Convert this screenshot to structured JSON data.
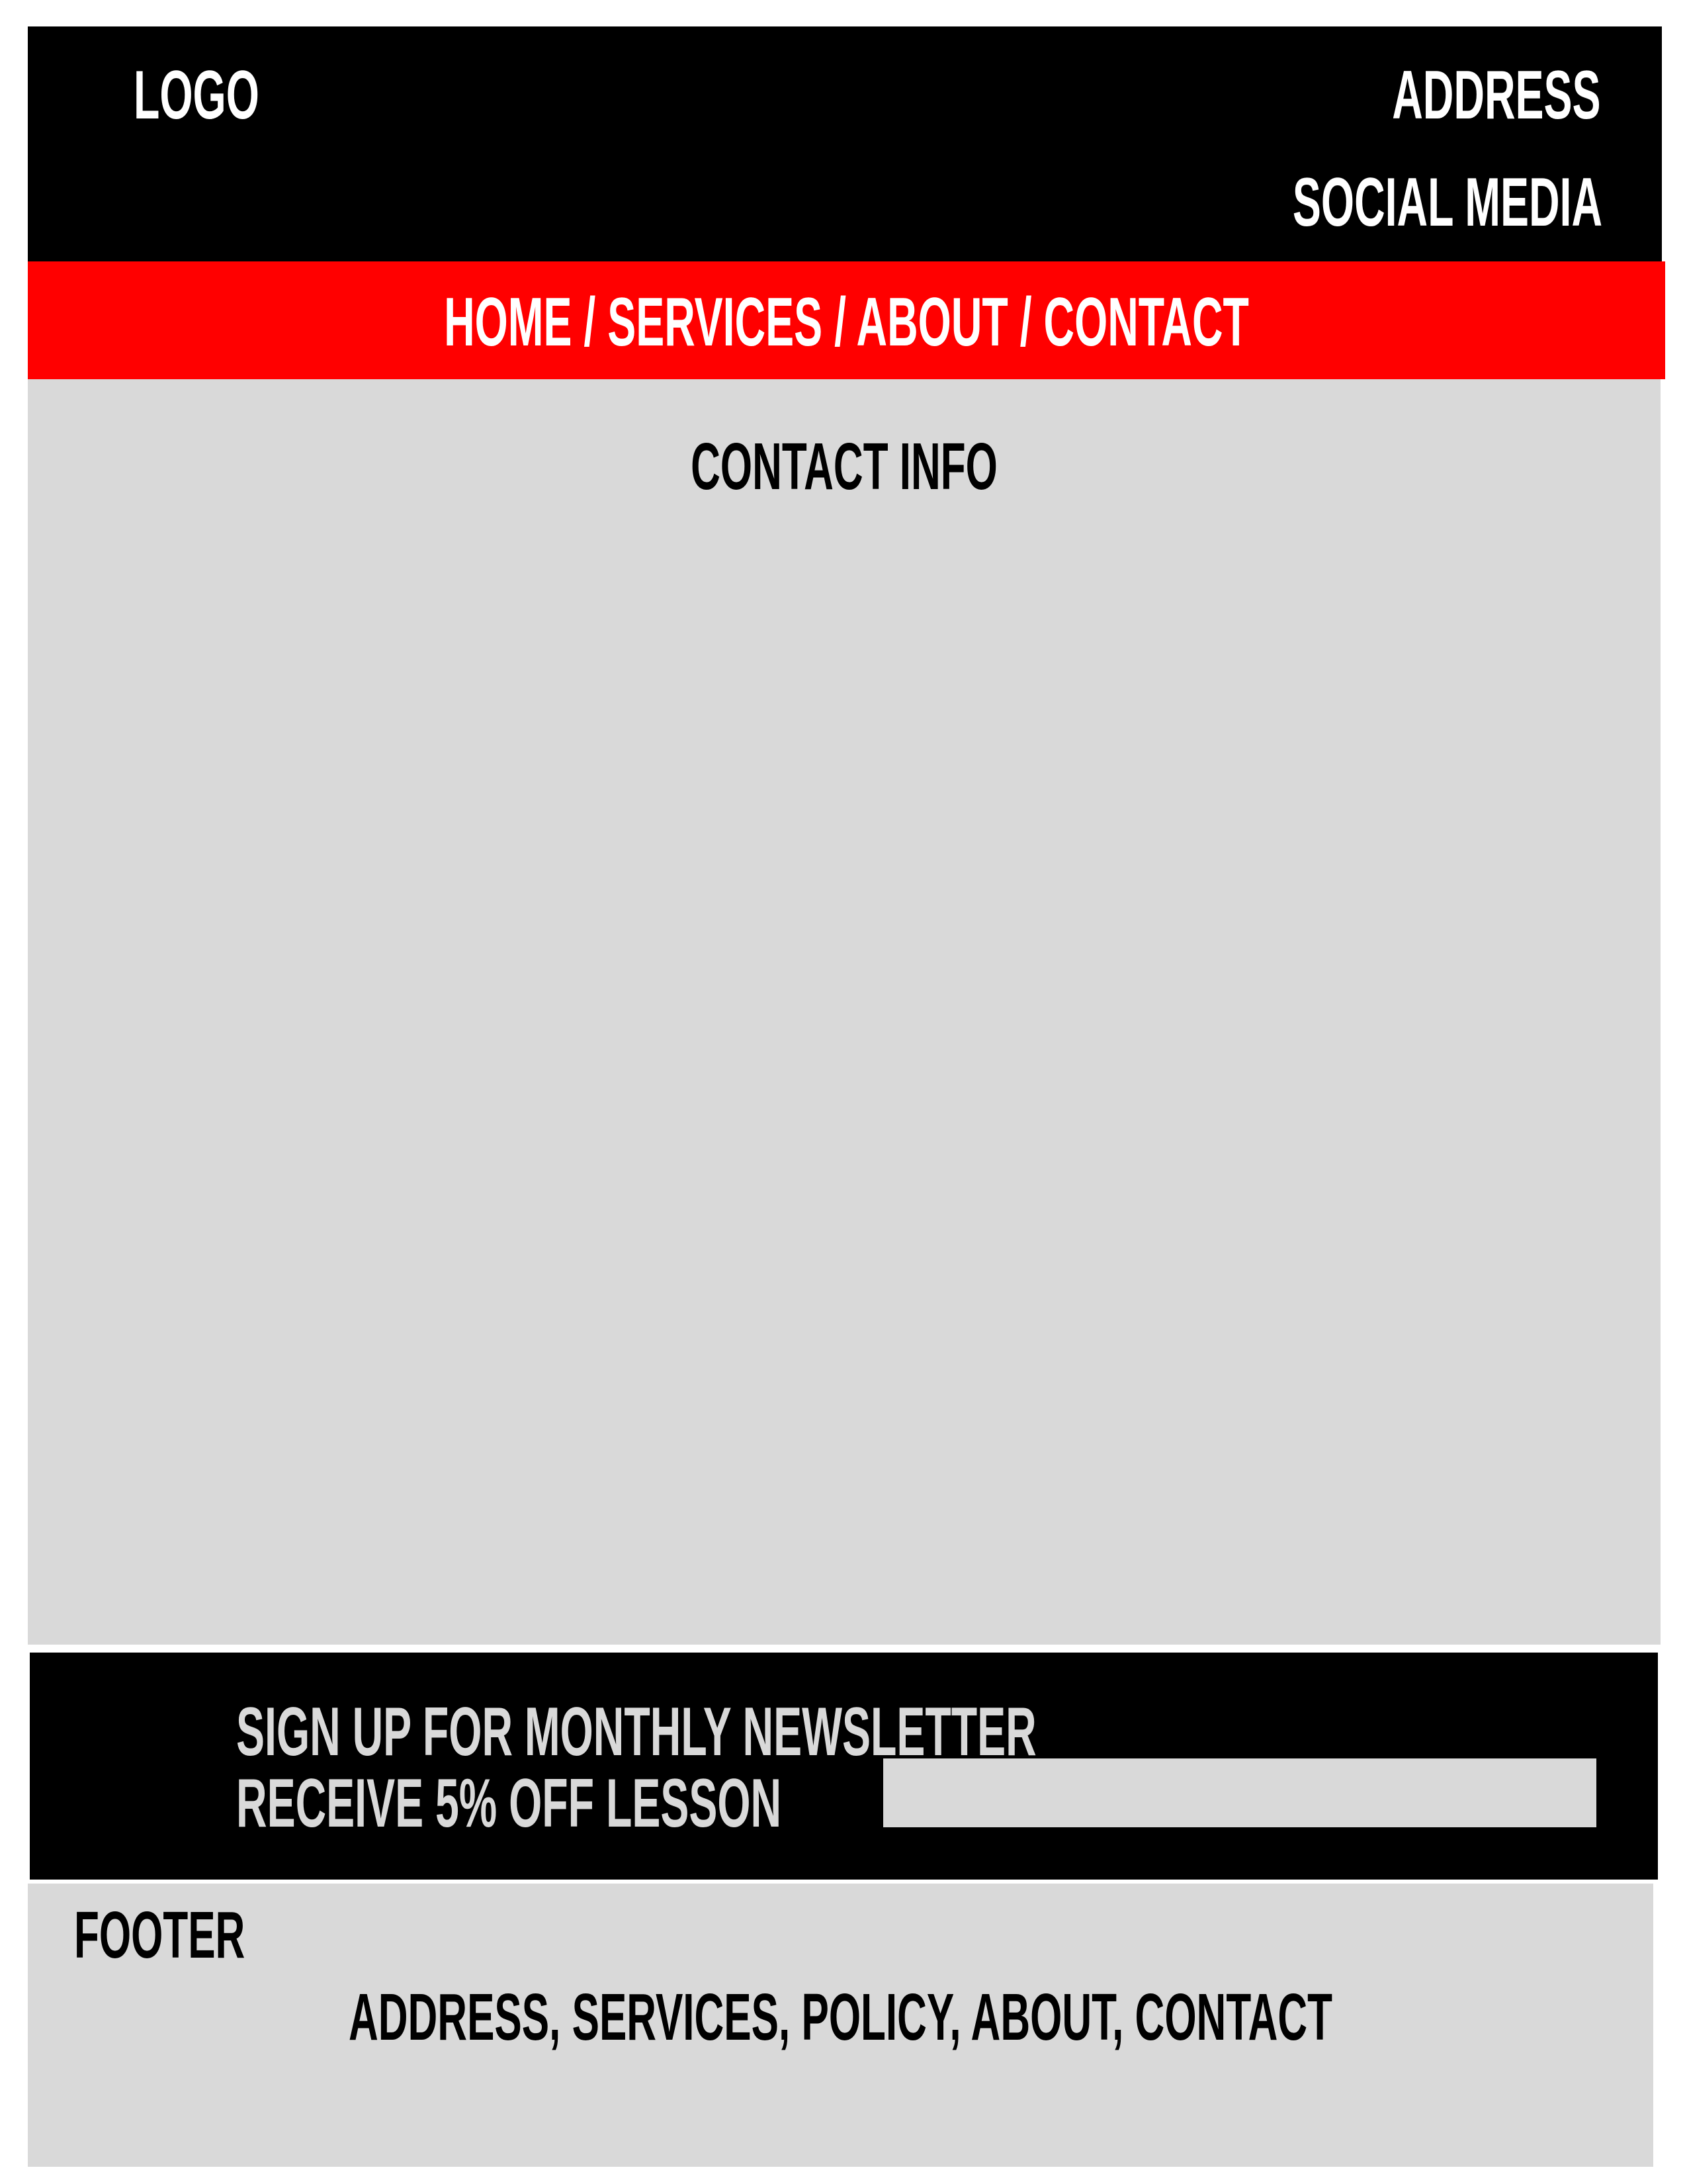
{
  "header": {
    "logo": "LOGO",
    "address": "ADDRESS",
    "social_media": "SOCIAL MEDIA"
  },
  "nav": {
    "links_text": "HOME / SERVICES / ABOUT / CONTACT"
  },
  "main": {
    "title": "CONTACT INFO"
  },
  "newsletter": {
    "line1": "SIGN UP FOR MONTHLY NEWSLETTER",
    "line2": "RECEIVE 5% OFF LESSON",
    "input_value": ""
  },
  "footer": {
    "title": "FOOTER",
    "links_text": "ADDRESS, SERVICES, POLICY, ABOUT, CONTACT"
  },
  "colors": {
    "header_bg": "#000000",
    "nav_bg": "#ff0000",
    "content_bg": "#d9d9d9",
    "newsletter_bg": "#000000",
    "newsletter_text": "#d9d9d9",
    "footer_bg": "#d9d9d9"
  }
}
